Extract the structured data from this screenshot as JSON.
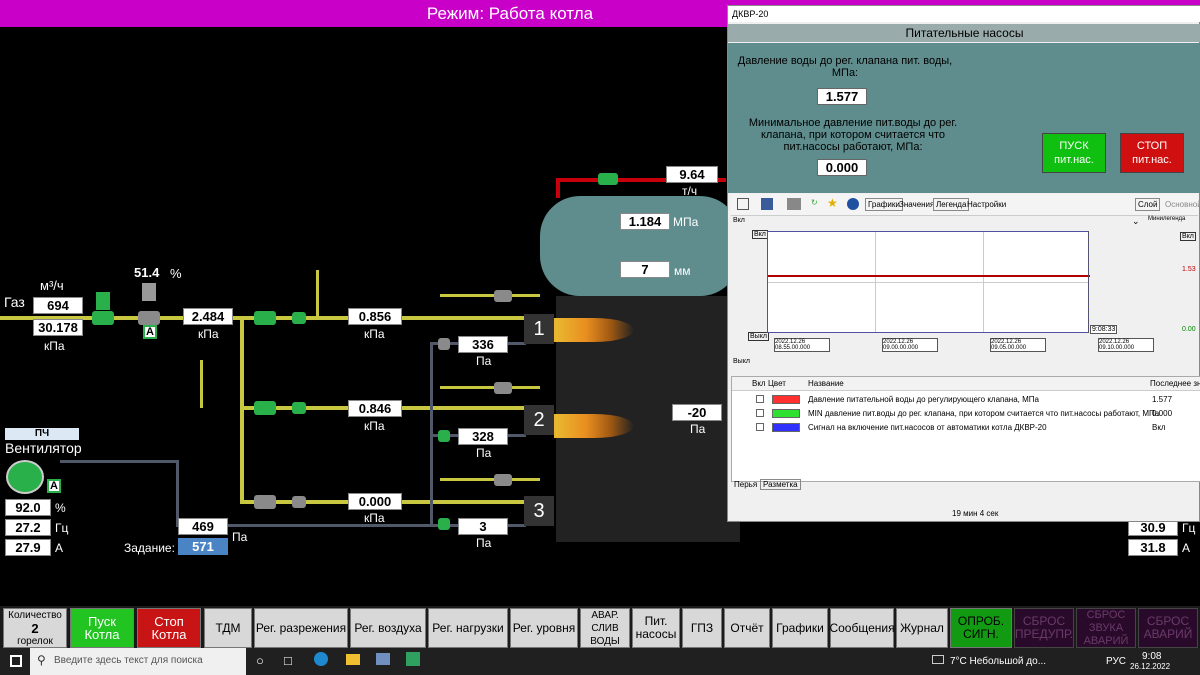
{
  "title": "Режим: Работа котла",
  "gas": {
    "label": "Газ",
    "flow_unit": "м³/ч",
    "flow": "694",
    "pressure": "30.178",
    "pressure_unit": "кПа"
  },
  "regulator": {
    "percent": "51.4",
    "percent_unit": "%",
    "mode": "A"
  },
  "p_after_reg": {
    "value": "2.484",
    "unit": "кПа"
  },
  "burner_pressures": [
    {
      "value": "0.856",
      "unit": "кПа"
    },
    {
      "value": "0.846",
      "unit": "кПа"
    },
    {
      "value": "0.000",
      "unit": "кПа"
    }
  ],
  "air_pressures": [
    {
      "value": "336",
      "unit": "Па"
    },
    {
      "value": "328",
      "unit": "Па"
    },
    {
      "value": "3",
      "unit": "Па"
    }
  ],
  "burner_numbers": [
    "1",
    "2",
    "3"
  ],
  "drum": {
    "pressure": "1.184",
    "pressure_unit": "МПа",
    "level": "7",
    "level_unit": "мм"
  },
  "steam": {
    "flow": "9.64",
    "unit": "т/ч"
  },
  "furnace": {
    "vacuum": "-20",
    "unit": "Па"
  },
  "fan": {
    "pch": "ПЧ",
    "label": "Вентилятор",
    "mode": "A",
    "percent": "92.0",
    "percent_unit": "%",
    "freq": "27.2",
    "freq_unit": "Гц",
    "current": "27.9",
    "current_unit": "А"
  },
  "air_main": {
    "value": "469",
    "unit": "Па",
    "setpoint_label": "Задание:",
    "setpoint": "571"
  },
  "right_values": [
    {
      "value": "30.9",
      "unit": "Гц"
    },
    {
      "value": "31.8",
      "unit": "А"
    }
  ],
  "bottom": {
    "count_label": "Количество",
    "count": "2",
    "count_unit": "горелок",
    "buttons": [
      "Пуск Котла",
      "Стоп Котла",
      "ТДМ",
      "Рег. разрежения",
      "Рег. воздуха",
      "Рег. нагрузки",
      "Рег. уровня",
      "АВАР. СЛИВ ВОДЫ",
      "Пит. насосы",
      "ГПЗ",
      "Отчёт",
      "Графики",
      "Сообщения",
      "Журнал",
      "ОПРОБ. СИГН.",
      "СБРОС ПРЕДУПР.",
      "СБРОС ЗВУКА АВАРИЙ",
      "СБРОС АВАРИЙ"
    ]
  },
  "window": {
    "title": "ДКВР-20",
    "caption": "Питательные насосы",
    "text1": "Давление воды до рег. клапана пит. воды, МПа:",
    "value1": "1.577",
    "text2": "Минимальное давление пит.воды до рег. клапана, при котором считается что пит.насосы работают, МПа:",
    "value2": "0.000",
    "start_btn": "ПУСК пит.нас.",
    "stop_btn": "СТОП пит.нас.",
    "tabs": [
      "Графики",
      "Значения",
      "Легенда",
      "Настройки"
    ],
    "right_tabs": [
      "Слой",
      "Основной"
    ],
    "minilegend": "Минилегенда",
    "axis_top": "Вкл",
    "axis_bot": "Выкл",
    "axis_right_top": "1.53",
    "axis_right_bot": "0.00",
    "cursor_time": "9:08:33",
    "time_labels": [
      "2022.12.26 08.55.00.000",
      "2022.12.26 09.00.00.000",
      "2022.12.26 09.05.00.000",
      "2022.12.26 09.10.00.000"
    ],
    "table_headers": [
      "Вкл",
      "Цвет",
      "Название",
      "Последнее зн"
    ],
    "table_rows": [
      {
        "color": "#ff3030",
        "name": "Давление питательной воды до регулирующего клапана, МПа",
        "last": "1.577"
      },
      {
        "color": "#30e030",
        "name": "MIN давление пит.воды до рег. клапана, при котором считается что пит.насосы работают, МПа",
        "last": "0.000"
      },
      {
        "color": "#3030ff",
        "name": "Сигнал на включение пит.насосов от автоматики котла ДКВР-20",
        "last": "Вкл"
      }
    ],
    "bottom_tabs": [
      "Перья",
      "Разметка"
    ],
    "status": "19 мин 4 сек"
  },
  "chart_data": {
    "type": "line",
    "series": [
      {
        "name": "Давление питательной воды до регулирующего клапана, МПа",
        "values": [
          1.577,
          1.577,
          1.577,
          1.577
        ]
      }
    ],
    "x": [
      "2022.12.26 08.55.00.000",
      "2022.12.26 09.00.00.000",
      "2022.12.26 09.05.00.000",
      "2022.12.26 09.10.00.000"
    ]
  },
  "taskbar": {
    "search": "Введите здесь текст для поиска",
    "weather": "7°C Небольшой до...",
    "lang": "РУС",
    "time": "9:08",
    "date": "26.12.2022"
  }
}
